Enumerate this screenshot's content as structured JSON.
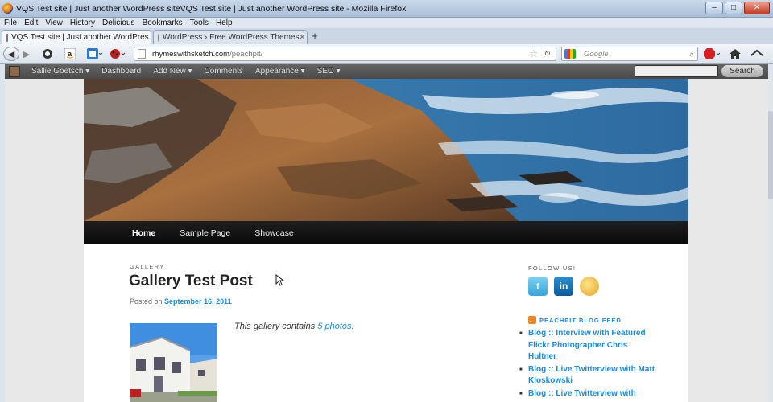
{
  "window": {
    "title": "VQS Test site | Just another WordPress siteVQS Test site | Just another WordPress site - Mozilla Firefox",
    "controls": {
      "minimize": "–",
      "maximize": "□",
      "close": "✕"
    }
  },
  "menubar": {
    "items": [
      {
        "label": "File"
      },
      {
        "label": "Edit"
      },
      {
        "label": "View"
      },
      {
        "label": "History"
      },
      {
        "label": "Delicious"
      },
      {
        "label": "Bookmarks"
      },
      {
        "label": "Tools"
      },
      {
        "label": "Help"
      }
    ]
  },
  "tabs": [
    {
      "label": "VQS Test site | Just another WordPres..."
    },
    {
      "label": "WordPress › Free WordPress Themes"
    }
  ],
  "newtab_label": "+",
  "navbar": {
    "url_host": "rhymeswithsketch.com",
    "url_path": "/peachpit/",
    "search_placeholder": "Google"
  },
  "wp_admin_bar": {
    "items": [
      {
        "label": "Sallie Goetsch ▾"
      },
      {
        "label": "Dashboard"
      },
      {
        "label": "Add New ▾"
      },
      {
        "label": "Comments"
      },
      {
        "label": "Appearance ▾"
      },
      {
        "label": "SEO ▾"
      }
    ],
    "search_button": "Search"
  },
  "site_nav": {
    "items": [
      {
        "label": "Home"
      },
      {
        "label": "Sample Page"
      },
      {
        "label": "Showcase"
      }
    ]
  },
  "post": {
    "kicker": "GALLERY",
    "title": "Gallery Test Post",
    "posted_on_label": "Posted on",
    "date": "September 16, 2011",
    "gallery_text": "This gallery contains",
    "gallery_link": "5 photos."
  },
  "sidebar": {
    "follow_title": "FOLLOW US!",
    "social": [
      {
        "icon": "twitter-icon",
        "glyph": "t"
      },
      {
        "icon": "linkedin-icon",
        "glyph": "in"
      },
      {
        "icon": "chat-icon",
        "glyph": ""
      }
    ],
    "feed_title": "PEACHPIT BLOG FEED",
    "feed_items": [
      {
        "label": "Blog :: Interview with Featured Flickr Photographer Chris Hultner"
      },
      {
        "label": "Blog :: Live Twitterview with Matt Kloskowski"
      },
      {
        "label": "Blog :: Live Twitterview with"
      }
    ]
  }
}
